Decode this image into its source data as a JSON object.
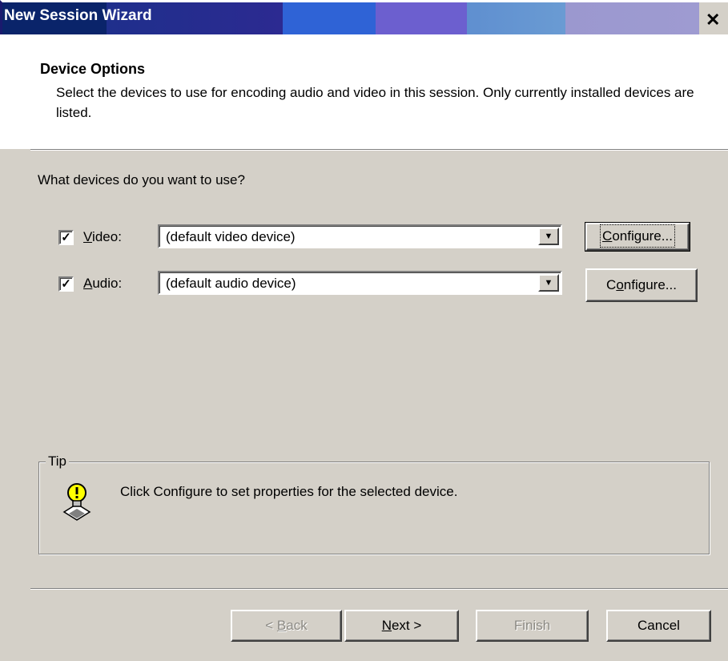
{
  "window": {
    "title": "New Session Wizard",
    "close_glyph": "✕"
  },
  "header": {
    "title": "Device Options",
    "description": "Select the devices to use for encoding audio and video in this session. Only currently installed devices are listed."
  },
  "question": "What devices do you want to use?",
  "devices": {
    "video": {
      "label_underline": "V",
      "label_rest": "ideo:",
      "checked": true,
      "check_glyph": "✓",
      "value": "(default video device)",
      "configure_pre": "",
      "configure_key": "C",
      "configure_post": "onfigure..."
    },
    "audio": {
      "label_underline": "A",
      "label_rest": "udio:",
      "checked": true,
      "check_glyph": "✓",
      "value": "(default audio device)",
      "configure_pre": "C",
      "configure_key": "o",
      "configure_post": "nfigure..."
    }
  },
  "tip": {
    "label": "Tip",
    "text": "Click Configure to set properties for the selected device.",
    "icon": "lightbulb-icon"
  },
  "footer": {
    "back_pre": "< ",
    "back_key": "B",
    "back_post": "ack",
    "next_key": "N",
    "next_post": "ext >",
    "finish": "Finish",
    "cancel": "Cancel"
  },
  "colors": {
    "titlebar_start": "#0a246a",
    "face": "#d4d0c8",
    "header_bg": "#ffffff",
    "disabled_text": "#8c8a84"
  }
}
